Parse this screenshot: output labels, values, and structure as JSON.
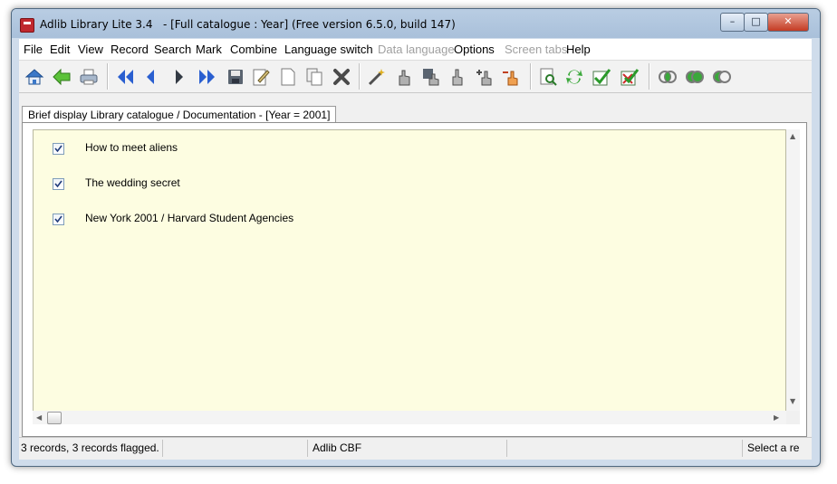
{
  "window": {
    "title": "Adlib Library Lite 3.4   - [Full catalogue : Year] (Free version 6.5.0, build 147)",
    "controls": {
      "minimize": "–",
      "maximize": "□",
      "close": "✕"
    }
  },
  "menu": {
    "file": "File",
    "edit": "Edit",
    "view": "View",
    "record": "Record",
    "search": "Search",
    "mark": "Mark",
    "combine": "Combine",
    "language_switch": "Language switch",
    "data_language": "Data language",
    "options": "Options",
    "screen_tabs": "Screen tabs",
    "help": "Help"
  },
  "toolbar_icons": [
    "home-icon",
    "back-arrow-icon",
    "print-icon",
    "first-record-icon",
    "previous-record-icon",
    "next-record-icon",
    "last-record-icon",
    "save-icon",
    "edit-icon",
    "new-record-icon",
    "copy-record-icon",
    "delete-icon",
    "wand-icon",
    "hand-pick-icon",
    "hand-save-icon",
    "hand-point-icon",
    "hand-add-icon",
    "hand-remove-icon",
    "search-record-icon",
    "refresh-icon",
    "check-icon",
    "check-cross-icon",
    "combine-and-icon",
    "combine-or-icon",
    "combine-not-icon"
  ],
  "tab": {
    "label": "Brief display Library catalogue / Documentation - [Year = 2001]"
  },
  "records": [
    {
      "label": "How to meet aliens",
      "checked": true
    },
    {
      "label": "The wedding secret",
      "checked": true
    },
    {
      "label": "New York 2001 / Harvard Student Agencies",
      "checked": true
    }
  ],
  "status": {
    "records": "3 records, 3 records flagged.",
    "database": "Adlib CBF",
    "hint": "Select a re"
  },
  "colors": {
    "list_background": "#fdfde1",
    "accent_blue": "#2a5fd0",
    "accent_green": "#3aa83a"
  }
}
